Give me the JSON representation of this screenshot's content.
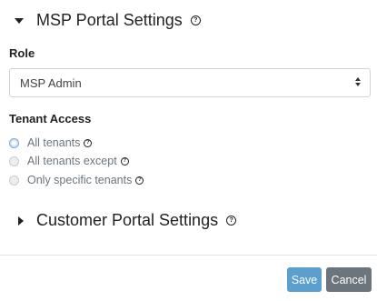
{
  "msp_section": {
    "title": "MSP Portal Settings",
    "expanded": true,
    "help_icon": "help-circle-icon"
  },
  "role": {
    "label": "Role",
    "selected": "MSP Admin"
  },
  "tenant_access": {
    "label": "Tenant Access",
    "options": [
      {
        "label": "All tenants",
        "checked": true
      },
      {
        "label": "All tenants except",
        "checked": false
      },
      {
        "label": "Only specific tenants",
        "checked": false
      }
    ]
  },
  "customer_section": {
    "title": "Customer Portal Settings",
    "expanded": false,
    "help_icon": "help-circle-icon"
  },
  "actions": {
    "save_label": "Save",
    "cancel_label": "Cancel"
  },
  "colors": {
    "save_button": "#5b9fce",
    "cancel_button": "#6c757d",
    "radio_checked": "#d6e4f5"
  }
}
